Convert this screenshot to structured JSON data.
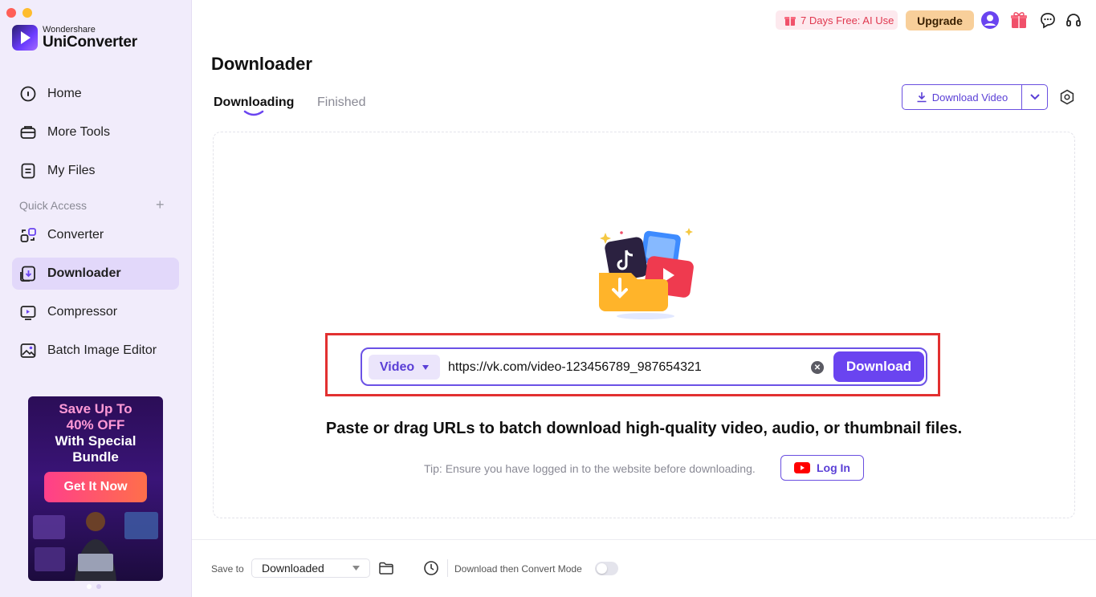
{
  "app": {
    "brand_small": "Wondershare",
    "brand_big": "UniConverter"
  },
  "sidebar": {
    "items": [
      {
        "label": "Home",
        "icon": "home-icon"
      },
      {
        "label": "More Tools",
        "icon": "toolbox-icon"
      },
      {
        "label": "My Files",
        "icon": "file-icon"
      }
    ],
    "quick_access_label": "Quick Access",
    "quick_items": [
      {
        "label": "Converter",
        "icon": "converter-icon"
      },
      {
        "label": "Downloader",
        "icon": "downloader-icon",
        "active": true
      },
      {
        "label": "Compressor",
        "icon": "compressor-icon"
      },
      {
        "label": "Batch Image Editor",
        "icon": "image-editor-icon"
      }
    ],
    "promo": {
      "line1": "Save Up To",
      "line2": "40% OFF",
      "line3": "With Special",
      "line4": "Bundle",
      "button": "Get It Now"
    }
  },
  "topbar": {
    "promo_text": "7 Days Free: AI Use",
    "upgrade_label": "Upgrade"
  },
  "main": {
    "title": "Downloader",
    "tabs": [
      {
        "label": "Downloading",
        "active": true
      },
      {
        "label": "Finished",
        "active": false
      }
    ],
    "download_video_label": "Download Video",
    "url_bar": {
      "type_label": "Video",
      "url_value": "https://vk.com/video-123456789_987654321",
      "download_label": "Download"
    },
    "headline": "Paste or drag URLs to batch download high-quality video, audio, or thumbnail files.",
    "tip": "Tip: Ensure you have logged in to the website before downloading.",
    "login_label": "Log In"
  },
  "footer": {
    "save_to_label": "Save to",
    "save_to_value": "Downloaded",
    "mode_label": "Download then Convert Mode",
    "mode_enabled": false
  },
  "colors": {
    "accent": "#6a44f0",
    "sidebar_bg": "#f1ecfb",
    "highlight_border": "#e23030",
    "upgrade_bg": "#f8cf9a"
  }
}
